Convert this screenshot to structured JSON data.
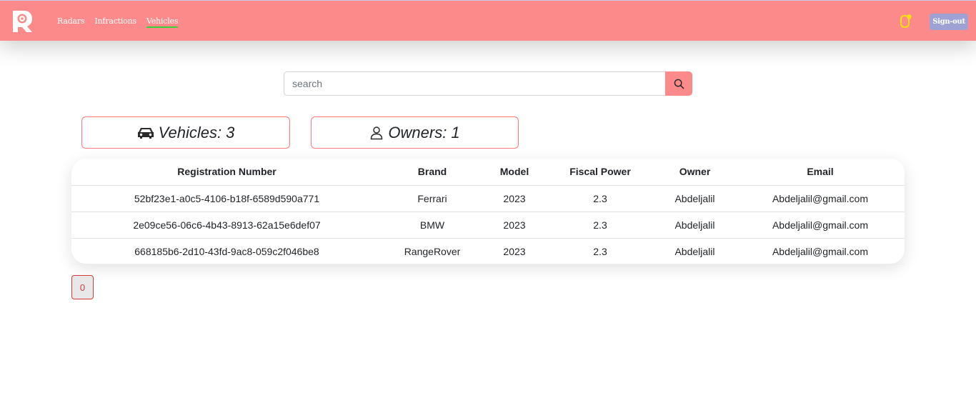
{
  "nav": {
    "links": [
      "Radars",
      "Infractions",
      "Vehicles"
    ],
    "active": "Vehicles",
    "signout_label": "Sign-out",
    "colors": {
      "bar": "#fd8a8a",
      "signout": "#9ea1d4",
      "active_underline": "#3bd13b",
      "bell": "#f5e20d"
    }
  },
  "search": {
    "placeholder": "search",
    "value": ""
  },
  "stats": {
    "vehicles_label": "Vehicles:",
    "vehicles_count": "3",
    "owners_label": "Owners:",
    "owners_count": "1"
  },
  "table": {
    "headers": [
      "Registration Number",
      "Brand",
      "Model",
      "Fiscal Power",
      "Owner",
      "Email"
    ],
    "rows": [
      [
        "52bf23e1-a0c5-4106-b18f-6589d590a771",
        "Ferrari",
        "2023",
        "2.3",
        "Abdeljalil",
        "Abdeljalil@gmail.com"
      ],
      [
        "2e09ce56-06c6-4b43-8913-62a15e6def07",
        "BMW",
        "2023",
        "2.3",
        "Abdeljalil",
        "Abdeljalil@gmail.com"
      ],
      [
        "668185b6-2d10-43fd-9ac8-059c2f046be8",
        "RangeRover",
        "2023",
        "2.3",
        "Abdeljalil",
        "Abdeljalil@gmail.com"
      ]
    ]
  },
  "pagination": {
    "pages": [
      "0"
    ],
    "current": "0"
  },
  "icons": {
    "logo": "radar-logo-icon",
    "bell": "bell-icon",
    "search": "search-icon",
    "car": "car-icon",
    "person": "person-icon"
  }
}
